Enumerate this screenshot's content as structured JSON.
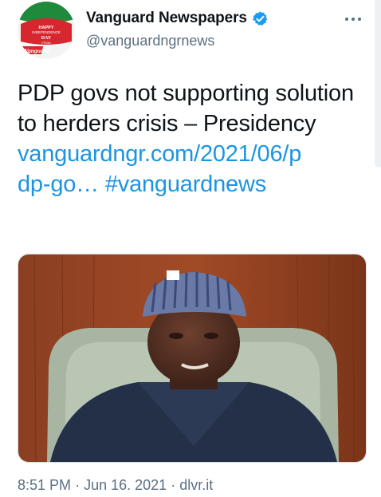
{
  "header": {
    "display_name": "Vanguard Newspapers",
    "handle": "@vanguardngrnews",
    "verified_icon": "verified-badge-icon",
    "more_icon": "more-options-icon",
    "avatar_text": {
      "line1": "HAPPY",
      "line2": "INDEPENDENCE",
      "line3": "DAY",
      "line4": "FROM",
      "brand": "Vanguard"
    }
  },
  "tweet": {
    "text": "PDP govs not supporting solution to herders crisis – Presidency",
    "link_text": "vanguardngr.com/2021/06/pdp-go…",
    "link_line1": "vanguardngr.com/2021/06/p",
    "link_line2": "dp-go…",
    "hashtag": "#vanguardnews"
  },
  "media": {
    "image_icon": "news-photo-image"
  },
  "meta": {
    "time": "8:51 PM",
    "date": "Jun 16. 2021",
    "source": "dlvr.it",
    "separator": "·"
  },
  "colors": {
    "link": "#1b95e0",
    "verified": "#1d9bf0",
    "secondary_text": "#5b7083",
    "primary_text": "#0f1419"
  }
}
